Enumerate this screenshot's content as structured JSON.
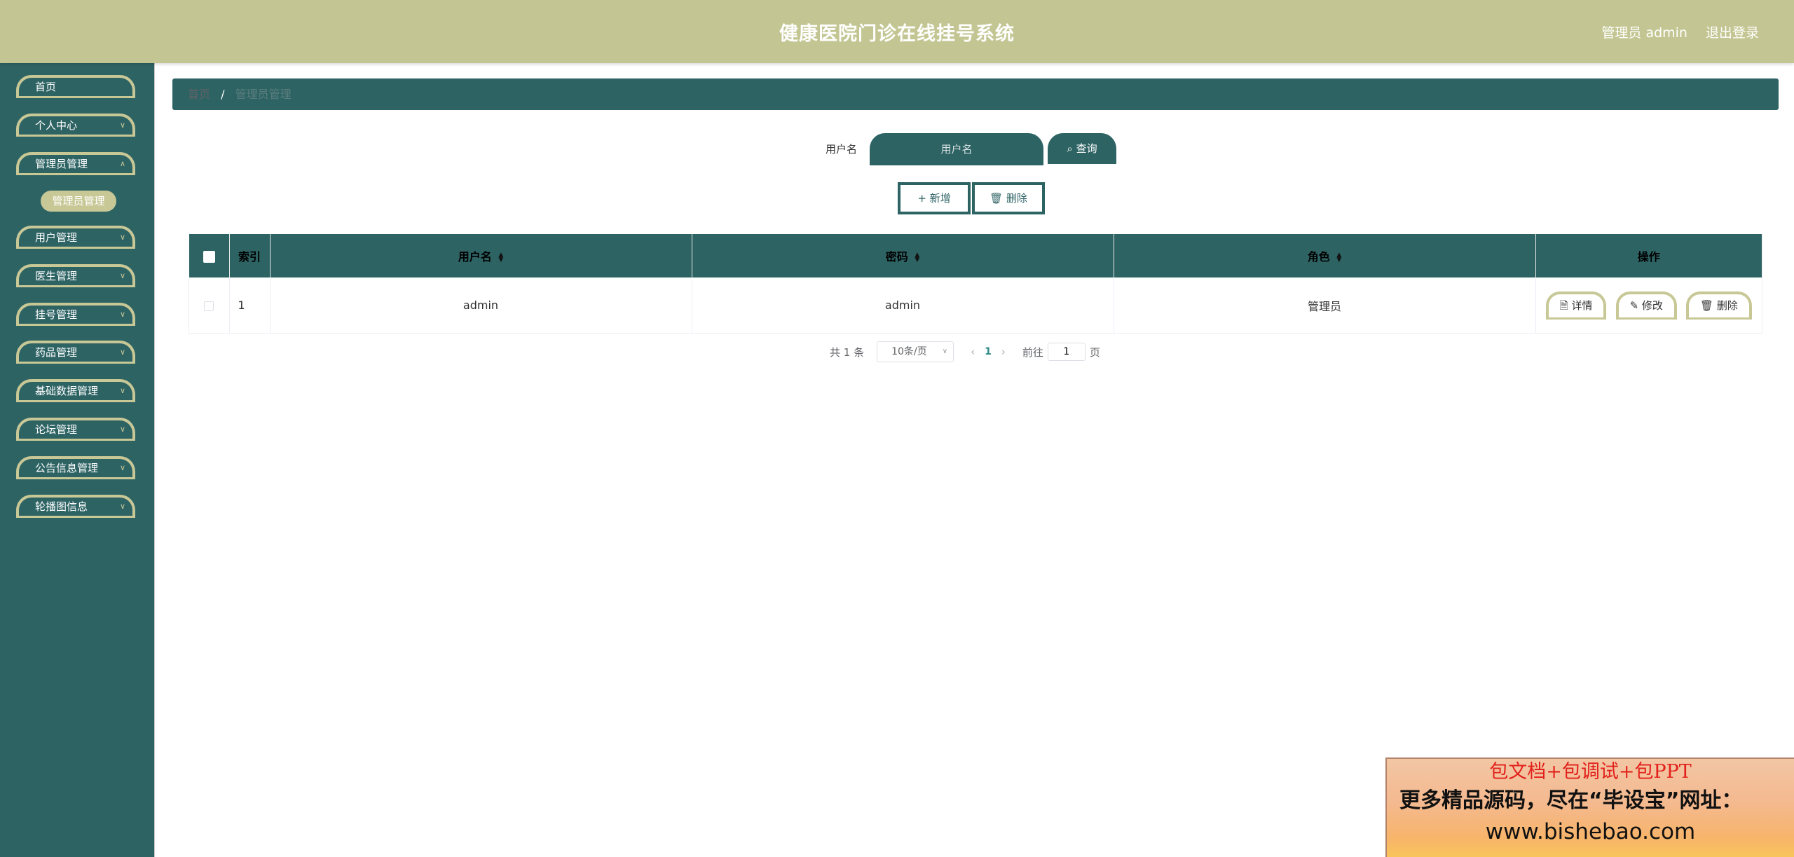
{
  "header": {
    "title": "健康医院门诊在线挂号系统",
    "user_label": "管理员 admin",
    "logout_label": "退出登录"
  },
  "sidebar": {
    "items": [
      {
        "label": "首页",
        "has_children": false
      },
      {
        "label": "个人中心",
        "has_children": true
      },
      {
        "label": "管理员管理",
        "has_children": true
      },
      {
        "label": "用户管理",
        "has_children": true
      },
      {
        "label": "医生管理",
        "has_children": true
      },
      {
        "label": "挂号管理",
        "has_children": true
      },
      {
        "label": "药品管理",
        "has_children": true
      },
      {
        "label": "基础数据管理",
        "has_children": true
      },
      {
        "label": "论坛管理",
        "has_children": true
      },
      {
        "label": "公告信息管理",
        "has_children": true
      },
      {
        "label": "轮播图信息",
        "has_children": true
      }
    ],
    "active_submenu": "管理员管理"
  },
  "breadcrumb": {
    "home": "首页",
    "separator": "/",
    "current": "管理员管理"
  },
  "search": {
    "label": "用户名",
    "placeholder": "用户名",
    "button_label": "查询"
  },
  "actions": {
    "add_label": "新增",
    "delete_label": "删除"
  },
  "table": {
    "columns": {
      "index": "索引",
      "username": "用户名",
      "password": "密码",
      "role": "角色",
      "operation": "操作"
    },
    "rows": [
      {
        "index": "1",
        "username": "admin",
        "password": "admin",
        "role": "管理员"
      }
    ],
    "row_actions": {
      "detail": "详情",
      "edit": "修改",
      "delete": "删除"
    }
  },
  "pagination": {
    "total_text": "共 1 条",
    "page_size": "10条/页",
    "current_page": "1",
    "goto_label": "前往",
    "goto_value": "1",
    "page_suffix": "页"
  },
  "promo": {
    "line1": "包文档+包调试+包PPT",
    "line2": "更多精品源码，尽在“毕设宝”网址：",
    "line3": "www.bishebao.com"
  },
  "colors": {
    "header_bg": "#c3c692",
    "primary_teal": "#2e6364",
    "accent_khaki": "#c8c897"
  }
}
